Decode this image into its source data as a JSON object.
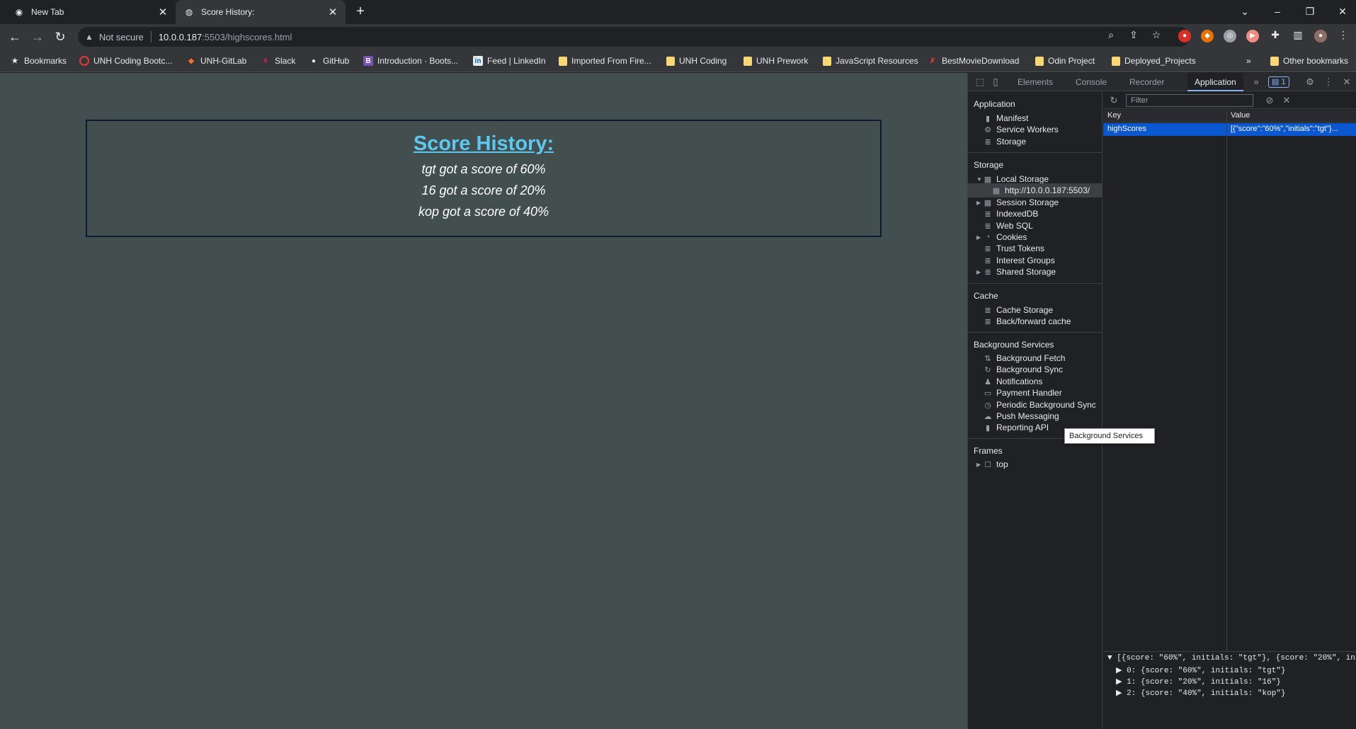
{
  "tabs": [
    {
      "title": "New Tab",
      "favicon": "chrome-icon"
    },
    {
      "title": "Score History:",
      "favicon": "globe-icon"
    }
  ],
  "toolbar": {
    "security_label": "Not secure",
    "url_host": "10.0.0.187",
    "url_path": ":5503/highscores.html"
  },
  "bookmarks": {
    "items": [
      {
        "label": "Bookmarks",
        "icon": "star-icon"
      },
      {
        "label": "UNH Coding Bootc...",
        "icon": "unh-icon",
        "color": "#e53935"
      },
      {
        "label": "UNH-GitLab",
        "icon": "gitlab-icon",
        "color": "#fc6d26"
      },
      {
        "label": "Slack",
        "icon": "slack-icon",
        "color": "#e01e5a"
      },
      {
        "label": "GitHub",
        "icon": "github-icon"
      },
      {
        "label": "Introduction · Boots...",
        "icon": "bootstrap-icon",
        "color": "#7952b3"
      },
      {
        "label": "Feed | LinkedIn",
        "icon": "linkedin-icon",
        "color": "#0a66c2"
      },
      {
        "label": "Imported From Fire...",
        "icon": "folder-icon"
      },
      {
        "label": "UNH Coding",
        "icon": "folder-icon"
      },
      {
        "label": "UNH Prework",
        "icon": "folder-icon"
      },
      {
        "label": "JavaScript Resources",
        "icon": "folder-icon"
      },
      {
        "label": "BestMovieDownload",
        "icon": "x-icon",
        "color": "#e53935"
      },
      {
        "label": "Odin Project",
        "icon": "folder-icon"
      },
      {
        "label": "Deployed_Projects",
        "icon": "folder-icon"
      }
    ],
    "overflow": "»",
    "other": "Other bookmarks"
  },
  "page": {
    "title": "Score History:",
    "scores": [
      "tgt got a score of 60%",
      "16 got a score of 20%",
      "kop got a score of 40%"
    ]
  },
  "devtools": {
    "tabs": [
      "Elements",
      "Console",
      "Recorder",
      "Application"
    ],
    "active_tab": "Application",
    "issues_count": "1",
    "sidebar": {
      "application_header": "Application",
      "application_items": [
        "Manifest",
        "Service Workers",
        "Storage"
      ],
      "storage_header": "Storage",
      "local_storage": "Local Storage",
      "local_storage_origin": "http://10.0.0.187:5503/",
      "storage_items": [
        "Session Storage",
        "IndexedDB",
        "Web SQL",
        "Cookies",
        "Trust Tokens",
        "Interest Groups",
        "Shared Storage"
      ],
      "cache_header": "Cache",
      "cache_items": [
        "Cache Storage",
        "Back/forward cache"
      ],
      "bg_header": "Background Services",
      "bg_items": [
        "Background Fetch",
        "Background Sync",
        "Notifications",
        "Payment Handler",
        "Periodic Background Sync",
        "Push Messaging",
        "Reporting API"
      ],
      "frames_header": "Frames",
      "frames_items": [
        "top"
      ]
    },
    "tooltip": "Background Services",
    "filter_placeholder": "Filter",
    "table": {
      "key_header": "Key",
      "value_header": "Value",
      "row_key": "highScores",
      "row_value": "[{\"score\":\"60%\",\"initials\":\"tgt\"}..."
    },
    "preview": {
      "summary": "[{score: \"60%\", initials: \"tgt\"}, {score: \"20%\", ini",
      "entries": [
        "0: {score: \"60%\", initials: \"tgt\"}",
        "1: {score: \"20%\", initials: \"16\"}",
        "2: {score: \"40%\", initials: \"kop\"}"
      ]
    }
  }
}
